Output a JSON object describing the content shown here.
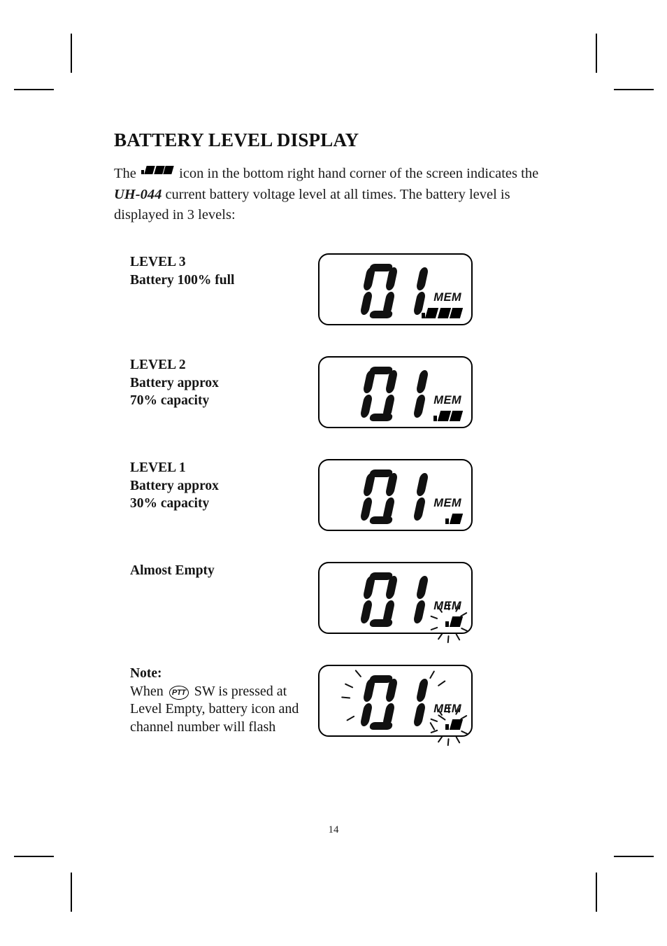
{
  "document": {
    "page_number": "14"
  },
  "heading": {
    "title": "BATTERY LEVEL DISPLAY"
  },
  "intro": {
    "part1": "The",
    "battery_icon": "battery-full-icon",
    "part2": "icon in the bottom right hand corner of the screen indicates the",
    "model": "UH-044",
    "part3": "current battery voltage level at all times.  The battery level is displayed in 3 levels:"
  },
  "lcd": {
    "digits": "01",
    "mem_label": "MEM"
  },
  "rows": [
    {
      "id": "level-3",
      "label_lines": [
        "LEVEL 3",
        "Battery 100% full"
      ],
      "battery_bars": 3,
      "flash_battery": false,
      "flash_digits": false
    },
    {
      "id": "level-2",
      "label_lines": [
        "LEVEL 2",
        "Battery approx",
        "70% capacity"
      ],
      "battery_bars": 2,
      "flash_battery": false,
      "flash_digits": false
    },
    {
      "id": "level-1",
      "label_lines": [
        "LEVEL 1",
        "Battery approx",
        "30% capacity"
      ],
      "battery_bars": 1,
      "flash_battery": false,
      "flash_digits": false
    },
    {
      "id": "almost-empty",
      "label_lines": [
        "Almost Empty"
      ],
      "battery_bars": 1,
      "flash_battery": true,
      "flash_digits": false
    },
    {
      "id": "note",
      "label_lines": [],
      "note_title": "Note:",
      "note_text_1": "When",
      "note_ptt": "PTT",
      "note_text_2": "SW is pressed at Level Empty, battery icon and channel number will flash",
      "battery_bars": 1,
      "flash_battery": true,
      "flash_digits": true
    }
  ],
  "colors": {
    "ink": "#111111",
    "paper": "#ffffff"
  }
}
